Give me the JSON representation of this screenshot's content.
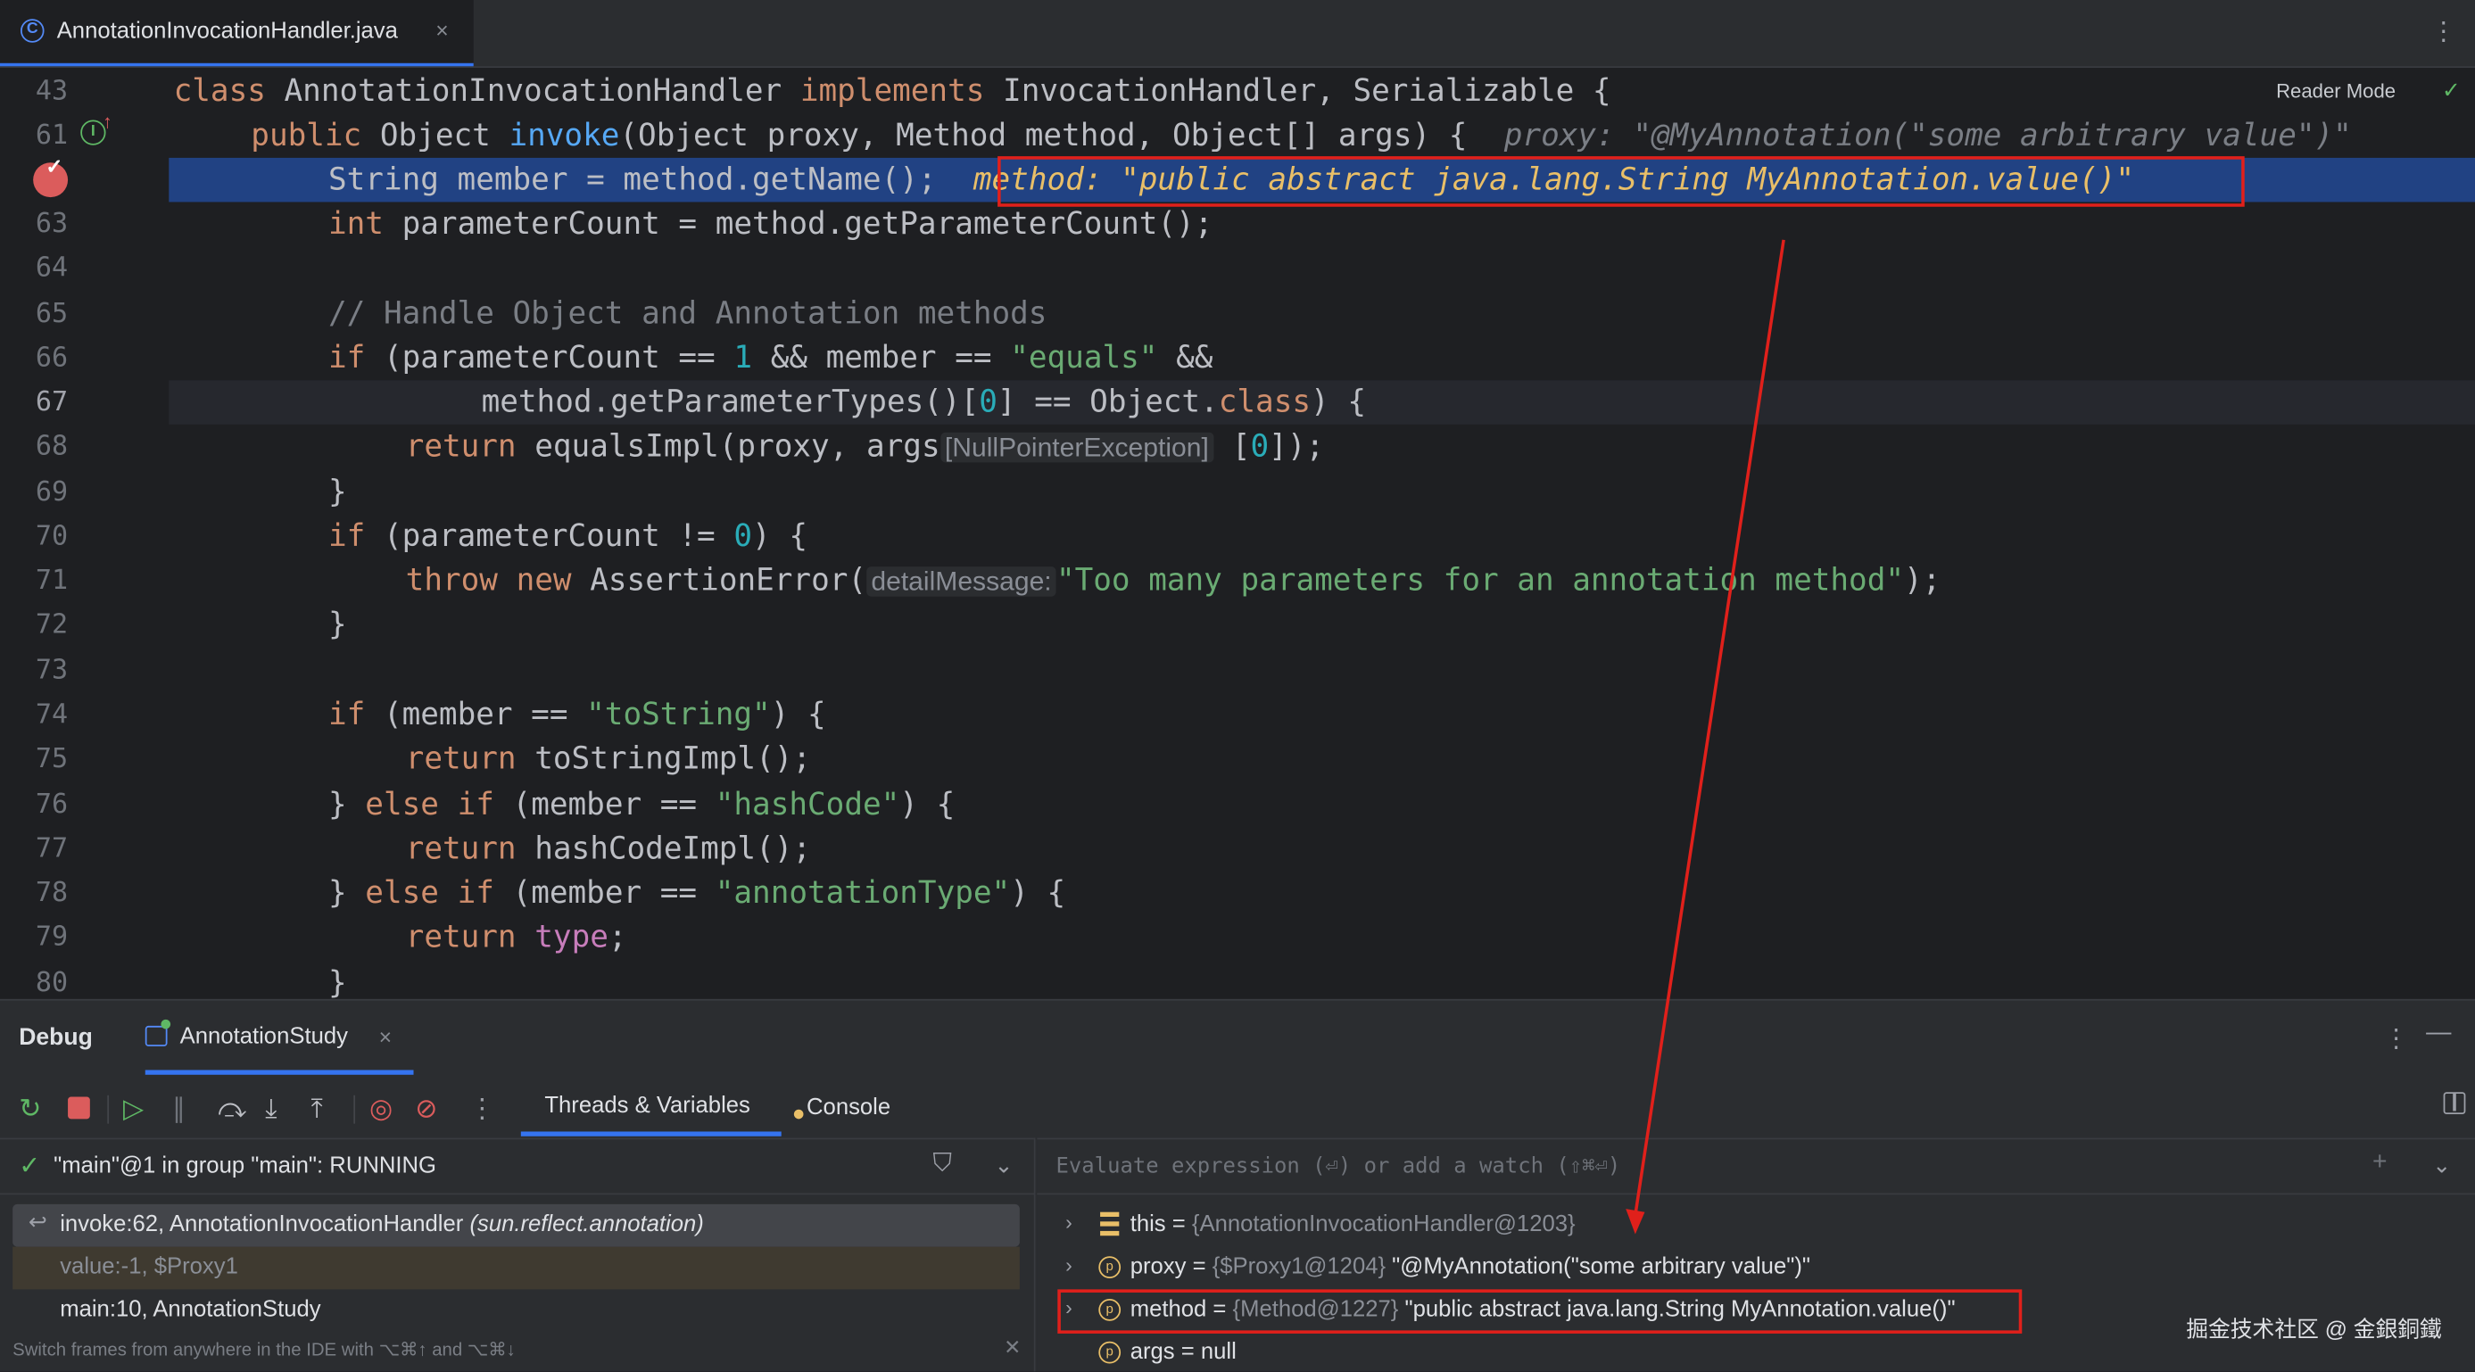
{
  "editor_tab": {
    "filename": "AnnotationInvocationHandler.java",
    "close": "×"
  },
  "reader_mode": "Reader Mode",
  "code_lines": [
    {
      "num": "43"
    },
    {
      "num": "61"
    },
    {
      "num": ""
    },
    {
      "num": "63"
    },
    {
      "num": "64"
    },
    {
      "num": "65"
    },
    {
      "num": "66"
    },
    {
      "num": "67"
    },
    {
      "num": "68"
    },
    {
      "num": "69"
    },
    {
      "num": "70"
    },
    {
      "num": "71"
    },
    {
      "num": "72"
    },
    {
      "num": "73"
    },
    {
      "num": "74"
    },
    {
      "num": "75"
    },
    {
      "num": "76"
    },
    {
      "num": "77"
    },
    {
      "num": "78"
    },
    {
      "num": "79"
    },
    {
      "num": "80"
    }
  ],
  "code": {
    "l43": {
      "kw1": "class",
      "t1": " AnnotationInvocationHandler ",
      "kw2": "implements",
      "t2": " InvocationHandler, Serializable {"
    },
    "l61": {
      "kw1": "public",
      "t1": " Object ",
      "fn": "invoke",
      "t2": "(Object proxy, Method method, Object[] args) {",
      "dbg": "proxy: \"@MyAnnotation(\"some arbitrary value\")\""
    },
    "l62": {
      "t1": "String member = method.getName();",
      "dbg_label": "method:",
      "dbg_val": " \"public abstract java.lang.String MyAnnotation.value()\""
    },
    "l63": {
      "kw1": "int",
      "t1": " parameterCount = method.getParameterCount();"
    },
    "l65": {
      "cmt": "// Handle Object and Annotation methods"
    },
    "l66": {
      "kw1": "if",
      "t1": " (parameterCount == ",
      "num": "1",
      "t2": " && member == ",
      "str": "\"equals\"",
      "t3": " &&"
    },
    "l67": {
      "t1": "method.getParameterTypes()[",
      "num": "0",
      "t2": "] == Object.",
      "kw": "class",
      "t3": ") {"
    },
    "l68": {
      "kw1": "return",
      "t1": " equalsImpl(proxy, args",
      "inlay": "[NullPointerException]",
      "t2": " [",
      "num": "0",
      "t3": "]);"
    },
    "l69": {
      "t1": "}"
    },
    "l70": {
      "kw1": "if",
      "t1": " (parameterCount != ",
      "num": "0",
      "t2": ") {"
    },
    "l71": {
      "kw1": "throw",
      "kw2": "new",
      "t1": " AssertionError(",
      "inlay": "detailMessage:",
      "str": "\"Too many parameters for an annotation method\"",
      "t2": ");"
    },
    "l72": {
      "t1": "}"
    },
    "l74": {
      "kw1": "if",
      "t1": " (member == ",
      "str": "\"toString\"",
      "t2": ") {"
    },
    "l75": {
      "kw1": "return",
      "t1": " toStringImpl();"
    },
    "l76": {
      "t0": "} ",
      "kw1": "else if",
      "t1": " (member == ",
      "str": "\"hashCode\"",
      "t2": ") {"
    },
    "l77": {
      "kw1": "return",
      "t1": " hashCodeImpl();"
    },
    "l78": {
      "t0": "} ",
      "kw1": "else if",
      "t1": " (member == ",
      "str": "\"annotationType\"",
      "t2": ") {"
    },
    "l79": {
      "kw1": "return",
      "pur": "type",
      "t1": ";"
    },
    "l80": {
      "t1": "}"
    }
  },
  "debug": {
    "title": "Debug",
    "session_tab": "AnnotationStudy",
    "session_close": "×",
    "tabs": {
      "threads_vars": "Threads & Variables",
      "console": "Console"
    },
    "thread": "\"main\"@1 in group \"main\": RUNNING",
    "frames": [
      {
        "main": "invoke:62, AnnotationInvocationHandler ",
        "pkg": "(sun.reflect.annotation)"
      },
      {
        "main": "value:-1, $Proxy1"
      },
      {
        "main": "main:10, AnnotationStudy"
      }
    ],
    "hint": "Switch frames from anywhere in the IDE with ⌥⌘↑ and ⌥⌘↓",
    "eval_placeholder": "Evaluate expression (⏎) or add a watch (⇧⌘⏎)",
    "variables": [
      {
        "name": "this",
        "eq": " = ",
        "type": "{AnnotationInvocationHandler@1203}",
        "value": ""
      },
      {
        "name": "proxy",
        "eq": " = ",
        "type": "{$Proxy1@1204}",
        "value": " \"@MyAnnotation(\"some arbitrary value\")\""
      },
      {
        "name": "method",
        "eq": " = ",
        "type": "{Method@1227}",
        "value": " \"public abstract java.lang.String MyAnnotation.value()\""
      },
      {
        "name": "args",
        "eq": " = ",
        "type": "",
        "value": "null"
      }
    ],
    "watermark": "掘金技术社区 @ 金銀銅鐵"
  },
  "colors": {
    "accent": "#3574f0",
    "highlight_box": "#e0201b",
    "selected_line": "#214283"
  }
}
